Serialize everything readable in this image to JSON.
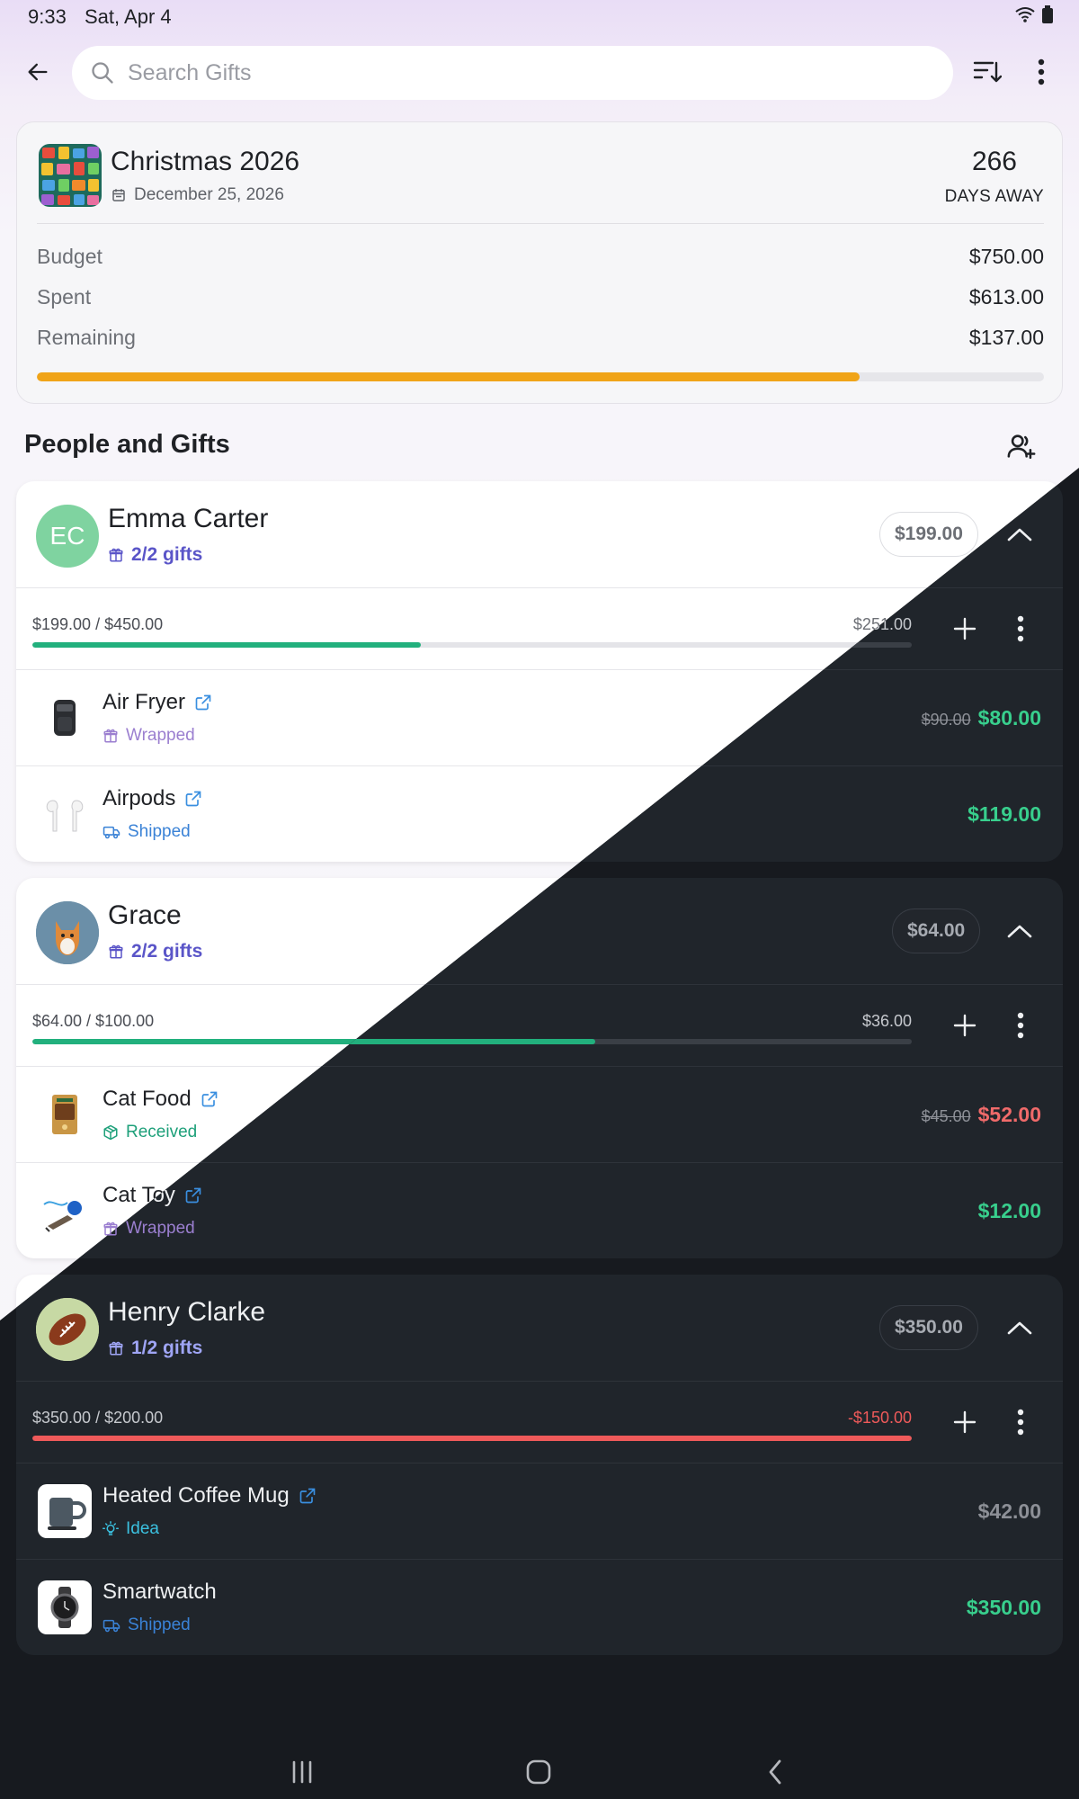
{
  "status_bar": {
    "time": "9:33",
    "date": "Sat, Apr 4"
  },
  "search": {
    "placeholder": "Search Gifts"
  },
  "event": {
    "title": "Christmas 2026",
    "date": "December 25, 2026",
    "days_number": "266",
    "days_label": "DAYS AWAY",
    "budget_label": "Budget",
    "budget_value": "$750.00",
    "spent_label": "Spent",
    "spent_value": "$613.00",
    "remaining_label": "Remaining",
    "remaining_value": "$137.00",
    "progress_percent": 81.7
  },
  "section": {
    "title": "People and Gifts"
  },
  "people": [
    {
      "initials": "EC",
      "name": "Emma Carter",
      "gifts_count": "2/2 gifts",
      "total": "$199.00",
      "budget_text": "$199.00 / $450.00",
      "remaining_text": "$251.00",
      "progress_percent": 44.2,
      "gifts": [
        {
          "name": "Air Fryer",
          "status": "Wrapped",
          "old_price": "$90.00",
          "price": "$80.00"
        },
        {
          "name": "Airpods",
          "status": "Shipped",
          "price": "$119.00"
        }
      ]
    },
    {
      "name": "Grace",
      "gifts_count": "2/2 gifts",
      "total": "$64.00",
      "budget_text": "$64.00 / $100.00",
      "remaining_text": "$36.00",
      "progress_percent": 64,
      "gifts": [
        {
          "name": "Cat Food",
          "status": "Received",
          "old_price": "$45.00",
          "price": "$52.00"
        },
        {
          "name": "Cat Toy",
          "status": "Wrapped",
          "price": "$12.00"
        }
      ]
    },
    {
      "name": "Henry Clarke",
      "gifts_count": "1/2 gifts",
      "total": "$350.00",
      "budget_text": "$350.00 / $200.00",
      "remaining_text": "-$150.00",
      "progress_percent": 100,
      "gifts": [
        {
          "name": "Heated Coffee Mug",
          "status": "Idea",
          "price": "$42.00"
        },
        {
          "name": "Smartwatch",
          "status": "Shipped",
          "price": "$350.00"
        }
      ]
    }
  ],
  "colors": {
    "accent_indigo": "#5a55c8",
    "progress_orange": "#f0a418",
    "progress_green": "#22b07d",
    "over_budget_red": "#ef5a5a",
    "price_green": "#38cf8d",
    "price_red": "#f06a6a",
    "status_wrapped": "#9b7fd0",
    "status_shipped": "#3a82d6",
    "status_received": "#1ea07a",
    "status_idea": "#3bc1e0"
  },
  "icons": {
    "back": "arrow-left-icon",
    "search": "search-icon",
    "sort": "sort-icon",
    "more": "more-vertical-icon",
    "calendar": "calendar-icon",
    "add_person": "add-person-icon",
    "gift": "gift-icon",
    "collapse": "chevron-up-icon",
    "add": "plus-icon",
    "external_link": "external-link-icon",
    "truck": "truck-icon",
    "package": "package-icon",
    "bulb": "lightbulb-icon"
  }
}
